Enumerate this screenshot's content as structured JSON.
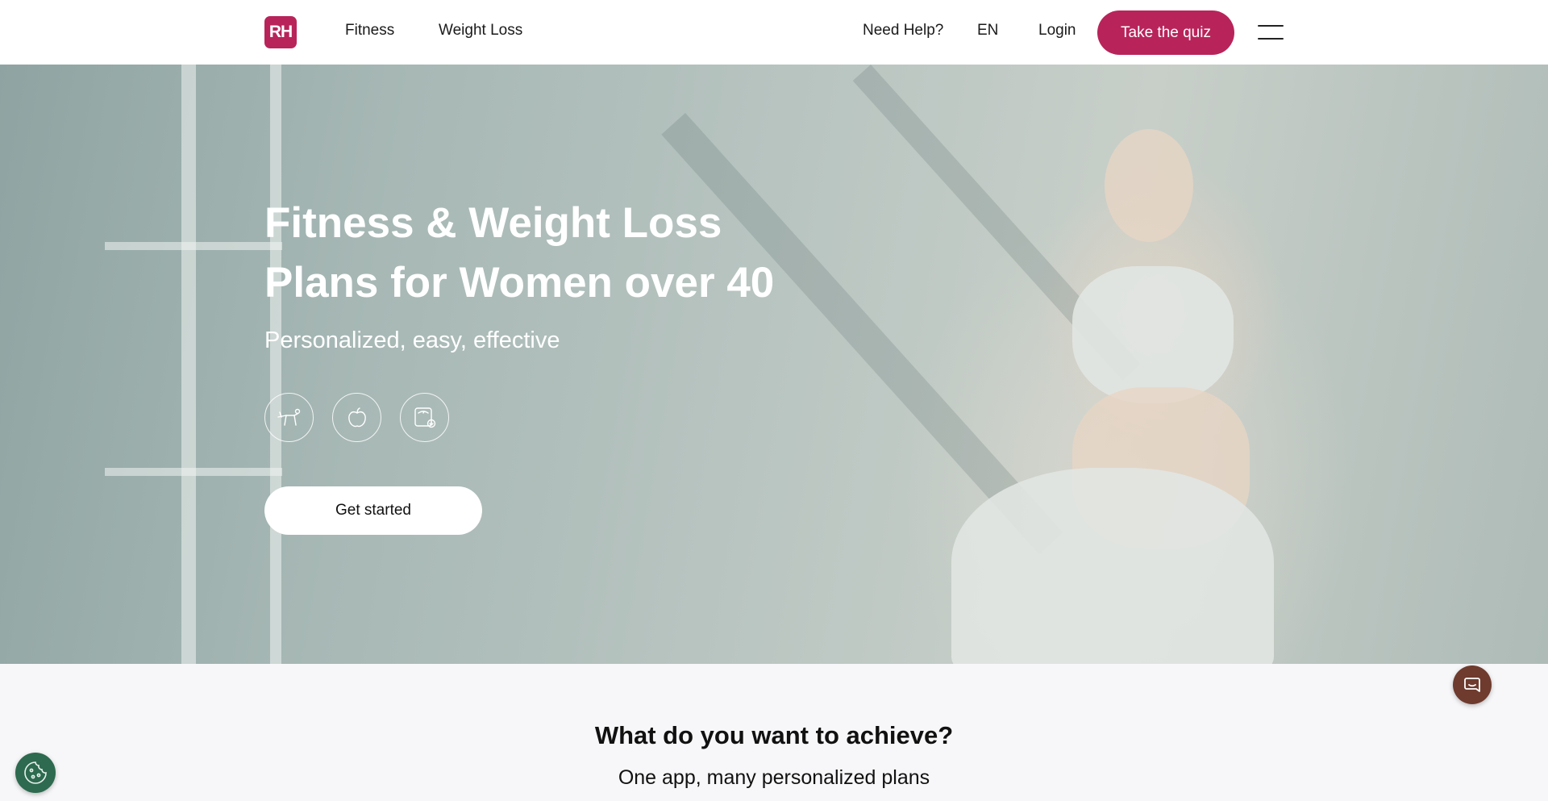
{
  "header": {
    "logo_text": "RH",
    "nav": [
      {
        "label": "Fitness"
      },
      {
        "label": "Weight Loss"
      }
    ],
    "help_label": "Need Help?",
    "language": "EN",
    "login_label": "Login",
    "quiz_label": "Take the quiz"
  },
  "hero": {
    "title": "Fitness & Weight Loss Plans for Women over 40",
    "subtitle": "Personalized, easy, effective",
    "features": [
      {
        "icon": "exercise-icon"
      },
      {
        "icon": "apple-icon"
      },
      {
        "icon": "scale-icon"
      }
    ],
    "cta_label": "Get started"
  },
  "section": {
    "title": "What do you want to achieve?",
    "subtitle": "One app, many personalized plans"
  },
  "colors": {
    "brand": "#b8245a",
    "chat": "#6e3b2e",
    "cookie": "#2d6a4f"
  }
}
